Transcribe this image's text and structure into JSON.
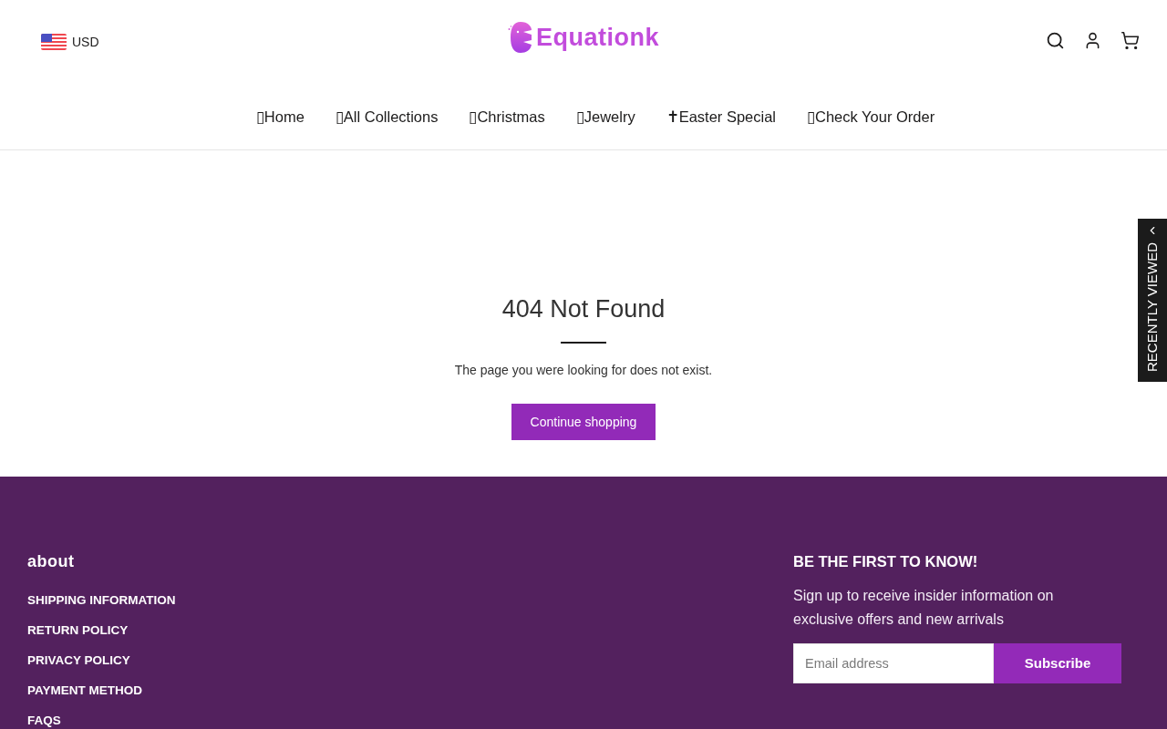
{
  "header": {
    "currency": "USD",
    "logo": "Equationk"
  },
  "nav": [
    {
      "label": "▯Home"
    },
    {
      "label": "▯All Collections"
    },
    {
      "label": "▯Christmas"
    },
    {
      "label": "▯Jewelry"
    },
    {
      "label": "✝Easter Special"
    },
    {
      "label": "▯Check Your Order"
    }
  ],
  "main": {
    "title": "404 Not Found",
    "message": "The page you were looking for does not exist.",
    "button": "Continue shopping"
  },
  "recently_viewed": "RECENTLY VIEWED",
  "footer": {
    "about": {
      "title": "about",
      "links": [
        "SHIPPING INFORMATION",
        "RETURN POLICY",
        "PRIVACY POLICY",
        "PAYMENT METHOD",
        "FAQS"
      ]
    },
    "newsletter": {
      "title": "BE THE FIRST TO KNOW!",
      "text": "Sign up to receive insider information on exclusive offers and new arrivals",
      "placeholder": "Email address",
      "button": "Subscribe"
    }
  }
}
